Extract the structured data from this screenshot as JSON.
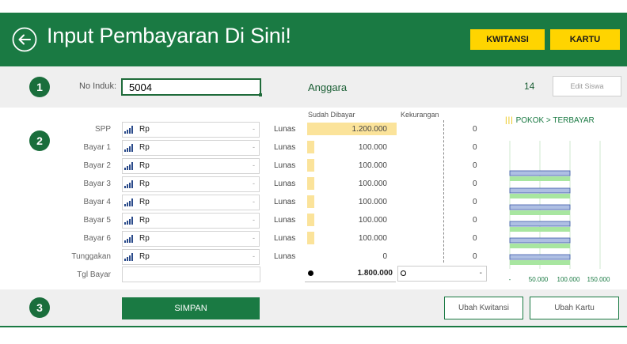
{
  "header": {
    "title": "Input Pembayaran Di Sini!",
    "kwitansi_label": "KWITANSI",
    "kartu_label": "KARTU"
  },
  "section1": {
    "step": "1",
    "no_induk_label": "No Induk:",
    "no_induk_value": "5004",
    "student_name": "Anggara",
    "count": "14",
    "edit_label": "Edit Siswa"
  },
  "section2": {
    "step": "2",
    "sudah_dibayar_header": "Sudah Dibayar",
    "kekurangan_header": "Kekurangan",
    "rows": [
      {
        "label": "SPP",
        "select": "Rp",
        "status": "Lunas",
        "paid": "1.200.000",
        "kurang": "0"
      },
      {
        "label": "Bayar 1",
        "select": "Rp",
        "status": "Lunas",
        "paid": "100.000",
        "kurang": "0"
      },
      {
        "label": "Bayar 2",
        "select": "Rp",
        "status": "Lunas",
        "paid": "100.000",
        "kurang": "0"
      },
      {
        "label": "Bayar 3",
        "select": "Rp",
        "status": "Lunas",
        "paid": "100.000",
        "kurang": "0"
      },
      {
        "label": "Bayar 4",
        "select": "Rp",
        "status": "Lunas",
        "paid": "100.000",
        "kurang": "0"
      },
      {
        "label": "Bayar 5",
        "select": "Rp",
        "status": "Lunas",
        "paid": "100.000",
        "kurang": "0"
      },
      {
        "label": "Bayar 6",
        "select": "Rp",
        "status": "Lunas",
        "paid": "100.000",
        "kurang": "0"
      },
      {
        "label": "Tunggakan",
        "select": "Rp",
        "status": "Lunas",
        "paid": "0",
        "kurang": "0"
      }
    ],
    "tgl_bayar_label": "Tgl Bayar",
    "tgl_bayar_value": "",
    "total_paid": "1.800.000",
    "total_kurang": "-"
  },
  "chart_data": {
    "type": "bar",
    "legend": "POKOK > TERBAYAR",
    "categories": [
      "SPP",
      "Bayar 1",
      "Bayar 2",
      "Bayar 3",
      "Bayar 4",
      "Bayar 5",
      "Bayar 6",
      "Tunggakan"
    ],
    "series": [],
    "x_ticks": [
      "-",
      "50.000",
      "100.000",
      "150.000"
    ],
    "xlim": [
      0,
      150000
    ],
    "grid": true,
    "colors": {
      "blue": "#aebfe3",
      "green": "#a8e6a0",
      "border": "#3d57a8",
      "text": "#1a7a43",
      "accent": "#ffd400"
    }
  },
  "section3": {
    "step": "3",
    "simpan_label": "SIMPAN",
    "ubah_kwitansi_label": "Ubah Kwitansi",
    "ubah_kartu_label": "Ubah Kartu"
  }
}
